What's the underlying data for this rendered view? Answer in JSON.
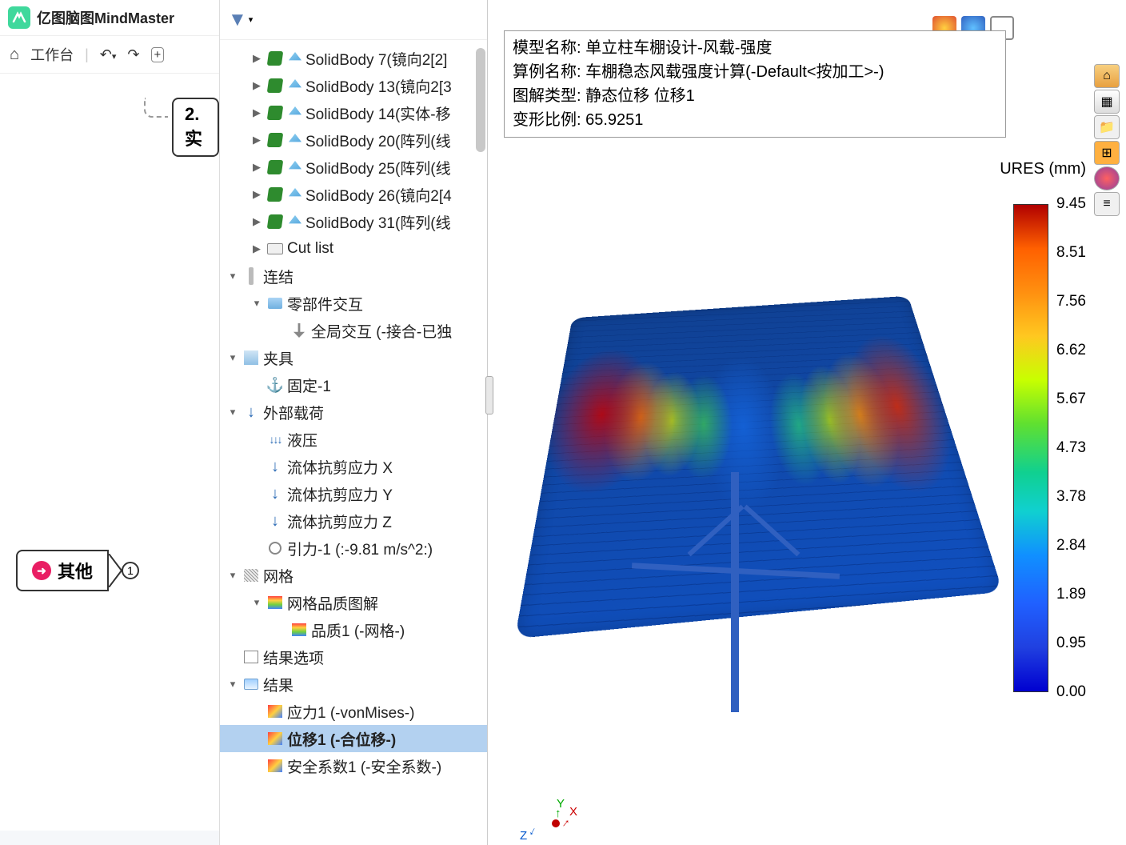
{
  "mindmaster": {
    "title": "亿图脑图MindMaster",
    "workbench": "工作台",
    "node1": "2.实",
    "other": "其他",
    "other_num": "1"
  },
  "tree": {
    "solidbodies": [
      "SolidBody 7(镜向2[2]",
      "SolidBody 13(镜向2[3",
      "SolidBody 14(实体-移",
      "SolidBody 20(阵列(线",
      "SolidBody 25(阵列(线",
      "SolidBody 26(镜向2[4",
      "SolidBody 31(阵列(线"
    ],
    "cutlist": "Cut list",
    "connections": "连结",
    "part_interact": "零部件交互",
    "global_interact": "全局交互 (-接合-已独",
    "fixture": "夹具",
    "fixed": "固定-1",
    "external_loads": "外部载荷",
    "pressure": "液压",
    "shear_x": "流体抗剪应力 X",
    "shear_y": "流体抗剪应力 Y",
    "shear_z": "流体抗剪应力 Z",
    "gravity": "引力-1 (:-9.81 m/s^2:)",
    "mesh": "网格",
    "mesh_quality": "网格品质图解",
    "quality1": "品质1 (-网格-)",
    "result_options": "结果选项",
    "results": "结果",
    "stress": "应力1 (-vonMises-)",
    "displacement": "位移1 (-合位移-)",
    "fos": "安全系数1 (-安全系数-)"
  },
  "info": {
    "model_label": "模型名称:",
    "model_value": "单立柱车棚设计-风载-强度",
    "study_label": "算例名称:",
    "study_value": "车棚稳态风载强度计算(-Default<按加工>-)",
    "plot_label": "图解类型:",
    "plot_value": "静态位移 位移1",
    "deform_label": "变形比例:",
    "deform_value": "65.9251"
  },
  "scale": {
    "title": "URES (mm)",
    "values": [
      "9.45",
      "8.51",
      "7.56",
      "6.62",
      "5.67",
      "4.73",
      "3.78",
      "2.84",
      "1.89",
      "0.95",
      "0.00"
    ]
  },
  "triad": {
    "x": "X",
    "y": "Y",
    "z": "Z"
  }
}
